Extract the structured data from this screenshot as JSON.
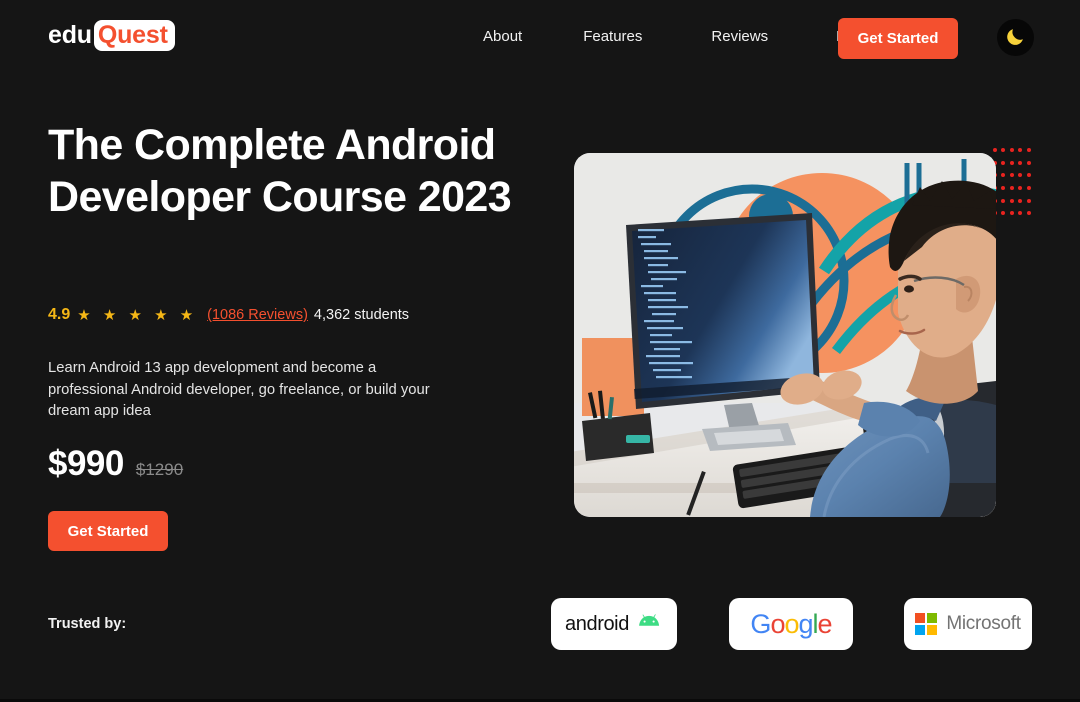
{
  "theme": {
    "background": "#151515",
    "accent": "#F4502F",
    "star_color": "#F5B716",
    "muted_text": "#8a8a8a"
  },
  "header": {
    "logo": {
      "part1": "edu",
      "part2": "Quest"
    },
    "nav_items": [
      {
        "label": "About"
      },
      {
        "label": "Features"
      },
      {
        "label": "Reviews"
      },
      {
        "label": "FAQs"
      }
    ],
    "cta_label": "Get Started",
    "theme_toggle_icon": "crescent-moon-icon"
  },
  "hero": {
    "title": "The Complete Android Developer Course 2023",
    "rating": {
      "score": "4.9",
      "stars": "★ ★ ★ ★ ★",
      "reviews_label": "(1086 Reviews)",
      "students_label": "4,362 students"
    },
    "description": "Learn Android 13 app development and become a professional Android developer, go freelance, or build your dream app idea",
    "price": {
      "current": "$990",
      "original": "$1290"
    },
    "cta_label": "Get Started",
    "image_alt": "man-coding-at-desk-photo"
  },
  "trusted_by": {
    "label": "Trusted by:",
    "brands": [
      {
        "name": "android",
        "text": "android",
        "icon": "android-robot-icon",
        "icon_color": "#3DDC84"
      },
      {
        "name": "google",
        "letters": [
          "G",
          "o",
          "o",
          "g",
          "l",
          "e"
        ]
      },
      {
        "name": "microsoft",
        "text": "Microsoft",
        "icon": "microsoft-squares-icon",
        "square_colors": [
          "#F25022",
          "#7FBA00",
          "#00A4EF",
          "#FFB900"
        ]
      }
    ]
  }
}
